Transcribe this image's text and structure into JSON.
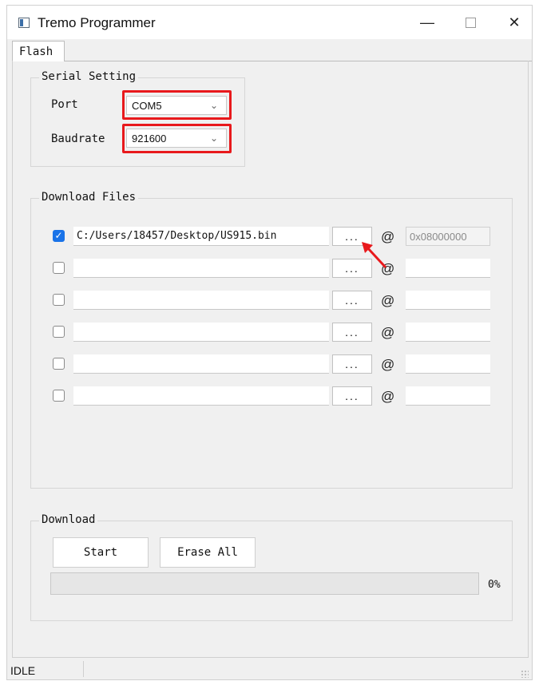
{
  "window": {
    "title": "Tremo Programmer",
    "controls": [
      "minimize",
      "maximize",
      "close"
    ]
  },
  "tabs": [
    {
      "label": "Flash"
    }
  ],
  "serial_setting": {
    "title": "Serial Setting",
    "port": {
      "label": "Port",
      "value": "COM5"
    },
    "baudrate": {
      "label": "Baudrate",
      "value": "921600"
    }
  },
  "download_files": {
    "title": "Download Files",
    "rows": [
      {
        "checked": true,
        "path": "C:/Users/18457/Desktop/US915.bin",
        "browse_label": "...",
        "at": "@",
        "address": "0x08000000"
      },
      {
        "checked": false,
        "path": "",
        "browse_label": "...",
        "at": "@",
        "address": ""
      },
      {
        "checked": false,
        "path": "",
        "browse_label": "...",
        "at": "@",
        "address": ""
      },
      {
        "checked": false,
        "path": "",
        "browse_label": "...",
        "at": "@",
        "address": ""
      },
      {
        "checked": false,
        "path": "",
        "browse_label": "...",
        "at": "@",
        "address": ""
      },
      {
        "checked": false,
        "path": "",
        "browse_label": "...",
        "at": "@",
        "address": ""
      }
    ]
  },
  "download": {
    "title": "Download",
    "start_label": "Start",
    "erase_label": "Erase All",
    "progress_percent": 0,
    "progress_text": "0%"
  },
  "status": {
    "text": "IDLE"
  },
  "colors": {
    "highlight": "#e8191c",
    "checkbox": "#1a73e8"
  },
  "icons": [
    "app-icon",
    "minimize-icon",
    "maximize-icon",
    "close-icon",
    "chevron-down-icon",
    "check-icon",
    "arrow-annotation"
  ]
}
